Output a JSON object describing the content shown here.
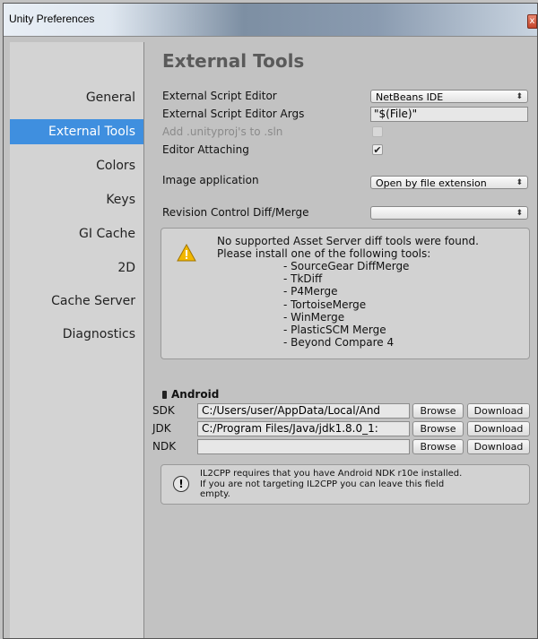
{
  "window": {
    "title": "Unity Preferences",
    "close_glyph": "x"
  },
  "sidebar": {
    "items": [
      {
        "label": "General"
      },
      {
        "label": "External Tools"
      },
      {
        "label": "Colors"
      },
      {
        "label": "Keys"
      },
      {
        "label": "GI Cache"
      },
      {
        "label": "2D"
      },
      {
        "label": "Cache Server"
      },
      {
        "label": "Diagnostics"
      }
    ],
    "selected": "External Tools",
    "selected_color": "#3f8fdf"
  },
  "page": {
    "title": "External Tools",
    "script_editor": {
      "label": "External Script Editor",
      "value": "NetBeans IDE"
    },
    "script_editor_args": {
      "label": "External Script Editor Args",
      "value": "\"$(File)\""
    },
    "unityproj": {
      "label": "Add .unityproj's to .sln",
      "checked": false
    },
    "editor_attaching": {
      "label": "Editor Attaching",
      "checked": true,
      "check_glyph": "✔"
    },
    "image_application": {
      "label": "Image application",
      "value": "Open by file extension"
    },
    "revision_control": {
      "label": "Revision Control Diff/Merge",
      "value": ""
    },
    "dropdown_arrow": "⬍",
    "diff_warning": {
      "line1": "No supported Asset Server diff tools were found.",
      "line2": "Please install one of the following tools:",
      "tools": [
        "- SourceGear DiffMerge",
        "- TkDiff",
        "- P4Merge",
        "- TortoiseMerge",
        "- WinMerge",
        "- PlasticSCM Merge",
        "- Beyond Compare 4"
      ]
    }
  },
  "android": {
    "title": "Android",
    "sdk": {
      "label": "SDK",
      "path": "C:/Users/user/AppData/Local/And"
    },
    "jdk": {
      "label": "JDK",
      "path": "C:/Program Files/Java/jdk1.8.0_1:"
    },
    "ndk": {
      "label": "NDK",
      "path": ""
    },
    "browse_label": "Browse",
    "download_label": "Download",
    "info": {
      "line1": "IL2CPP requires that you have Android NDK r10e installed.",
      "line2": "If you are not targeting IL2CPP you can leave this field",
      "line3": "empty.",
      "glyph": "!"
    }
  },
  "colors": {
    "warning_icon": "#f2b800"
  }
}
